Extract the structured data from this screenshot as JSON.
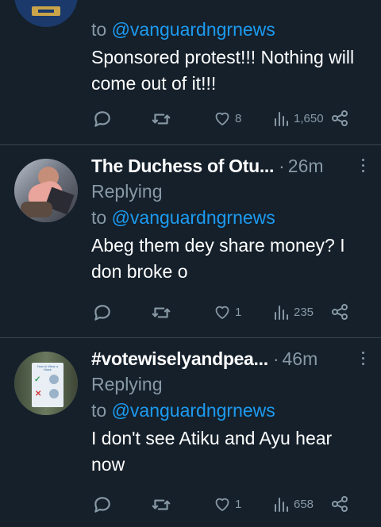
{
  "tweets": [
    {
      "name": "",
      "time": "",
      "replying_label": "",
      "to_prefix": "to ",
      "handle": "@vanguardngrnews",
      "text": "Sponsored protest!!! Nothing will come out of it!!!",
      "likes": "8",
      "views": "1,650"
    },
    {
      "name": "The Duchess of Otu...",
      "time": "26m",
      "replying_label": "Replying",
      "to_prefix": "to ",
      "handle": "@vanguardngrnews",
      "text": "Abeg them dey share money? I don broke o",
      "likes": "1",
      "views": "235"
    },
    {
      "name": "#votewiselyandpea...",
      "time": "46m",
      "replying_label": "Replying",
      "to_prefix": "to ",
      "handle": "@vanguardngrnews",
      "text": "I don't see Atiku and Ayu hear now",
      "likes": "1",
      "views": "658"
    }
  ],
  "separator": "·",
  "avatar3_sign": {
    "title": "How to Wear a Mask"
  },
  "icons": [
    "reply-icon",
    "retweet-icon",
    "like-icon",
    "views-icon",
    "share-icon",
    "more-icon"
  ],
  "colors": {
    "background": "#15202b",
    "link": "#1d9bf0",
    "muted": "#8899a6",
    "divider": "#38444d"
  }
}
